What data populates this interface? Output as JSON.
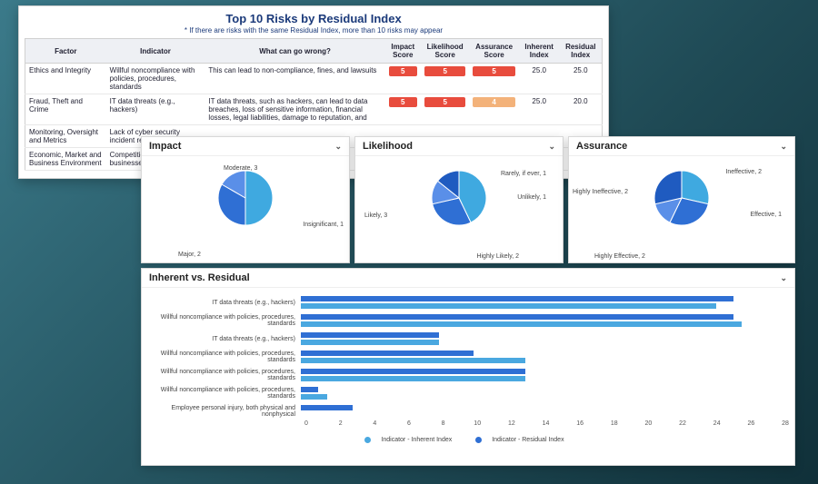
{
  "risk_table": {
    "title": "Top 10 Risks by Residual Index",
    "note": "*   If there are risks with the same Residual Index, more than 10 risks may appear",
    "headers": [
      "Factor",
      "Indicator",
      "What can go wrong?",
      "Impact Score",
      "Likelihood Score",
      "Assurance Score",
      "Inherent Index",
      "Residual Index"
    ],
    "rows": [
      {
        "factor": "Ethics and Integrity",
        "indicator": "Willful noncompliance with policies, procedures, standards",
        "wrong": "This can lead to non-compliance, fines, and lawsuits",
        "impact": "5",
        "impactCls": "sc5",
        "like": "5",
        "likeCls": "sc5",
        "assur": "5",
        "assurCls": "sc5",
        "inh": "25.0",
        "res": "25.0"
      },
      {
        "factor": "Fraud, Theft and Crime",
        "indicator": "IT data threats (e.g., hackers)",
        "wrong": "IT data threats, such as hackers, can lead to data breaches, loss of sensitive information, financial losses, legal liabilities, damage to reputation, and",
        "impact": "5",
        "impactCls": "sc5",
        "like": "5",
        "likeCls": "sc5",
        "assur": "4",
        "assurCls": "sc4",
        "inh": "25.0",
        "res": "20.0"
      },
      {
        "factor": "Monitoring, Oversight and Metrics",
        "indicator": "Lack of cyber security incident response",
        "wrong": "",
        "impact": "",
        "impactCls": "",
        "like": "",
        "likeCls": "",
        "assur": "",
        "assurCls": "",
        "inh": "",
        "res": ""
      },
      {
        "factor": "Economic, Market and Business Environment",
        "indicator": "Competition from existing businesses",
        "wrong": "",
        "impact": "",
        "impactCls": "",
        "like": "",
        "likeCls": "",
        "assur": "",
        "assurCls": "",
        "inh": "",
        "res": ""
      }
    ]
  },
  "cards": {
    "impact": {
      "title": "Impact"
    },
    "likelihood": {
      "title": "Likelihood"
    },
    "assurance": {
      "title": "Assurance"
    },
    "inh": {
      "title": "Inherent vs. Residual"
    }
  },
  "legend": {
    "a": "Indicator - Inherent Index",
    "b": "Indicator - Residual Index"
  },
  "chart_data": [
    {
      "id": "impact",
      "type": "pie",
      "title": "Impact",
      "series": [
        {
          "name": "Moderate",
          "value": 3
        },
        {
          "name": "Major",
          "value": 2
        },
        {
          "name": "Insignificant",
          "value": 1
        }
      ],
      "labels": [
        "Moderate, 3",
        "Major, 2",
        "Insignificant, 1"
      ]
    },
    {
      "id": "likelihood",
      "type": "pie",
      "title": "Likelihood",
      "series": [
        {
          "name": "Likely",
          "value": 3
        },
        {
          "name": "Highly Likely",
          "value": 2
        },
        {
          "name": "Unlikely",
          "value": 1
        },
        {
          "name": "Rarely, if ever",
          "value": 1
        }
      ],
      "labels": [
        "Likely, 3",
        "Highly Likely, 2",
        "Unlikely, 1",
        "Rarely, if ever, 1"
      ]
    },
    {
      "id": "assurance",
      "type": "pie",
      "title": "Assurance",
      "series": [
        {
          "name": "Highly Ineffective",
          "value": 2
        },
        {
          "name": "Ineffective",
          "value": 2
        },
        {
          "name": "Effective",
          "value": 1
        },
        {
          "name": "Highly Effective",
          "value": 2
        }
      ],
      "labels": [
        "Highly Ineffective, 2",
        "Ineffective, 2",
        "Effective, 1",
        "Highly Effective, 2"
      ]
    },
    {
      "id": "inherent_vs_residual",
      "type": "bar",
      "orientation": "horizontal",
      "title": "Inherent vs. Residual",
      "xlim": [
        0,
        28
      ],
      "xticks": [
        0,
        2,
        4,
        6,
        8,
        10,
        12,
        14,
        16,
        18,
        20,
        22,
        24,
        26,
        28
      ],
      "categories": [
        "IT data threats (e.g., hackers)",
        "Willful noncompliance with policies, procedures, standards",
        "IT data threats (e.g., hackers)",
        "Willful noncompliance with policies, procedures, standards",
        "Willful noncompliance with policies, procedures, standards",
        "Willful noncompliance with policies, procedures, standards",
        "Employee personal injury, both physical and nonphysical"
      ],
      "series": [
        {
          "name": "Indicator - Inherent Index",
          "values": [
            25,
            25,
            8,
            10,
            13,
            1,
            3
          ]
        },
        {
          "name": "Indicator - Residual Index",
          "values": [
            24,
            25.5,
            8,
            13,
            13,
            1.5,
            0
          ]
        }
      ]
    }
  ]
}
